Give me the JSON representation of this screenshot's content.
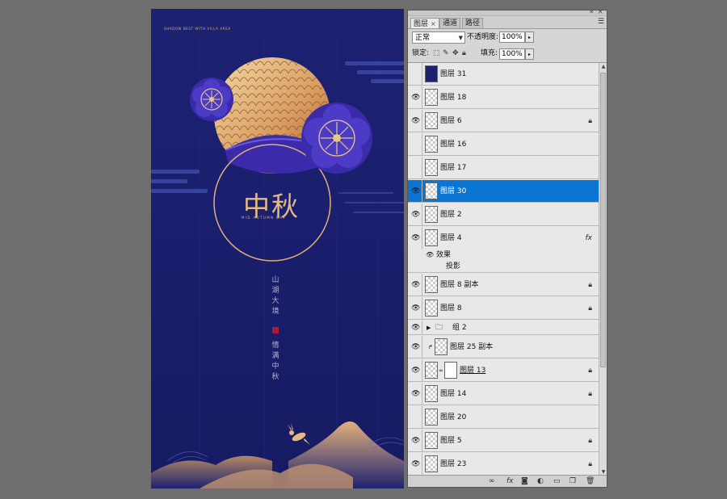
{
  "poster": {
    "tiny_text": "SHADOW BEST WITH VILLA AREA",
    "title": "中秋",
    "subtitle": "MID AUTUMN DAY",
    "vertical_line1": [
      "山",
      "湖",
      "大",
      "境"
    ],
    "vertical_line2": [
      "情",
      "满",
      "中",
      "秋"
    ],
    "colors": {
      "background": "#1c2170",
      "gold": "#e5b982",
      "flower": "#3b2bab",
      "seal": "#b0183b"
    }
  },
  "panel": {
    "top_icons": {
      "collapse": "«",
      "close": "×"
    },
    "tabs": [
      {
        "label": "图层",
        "close": "×",
        "active": true
      },
      {
        "label": "通道",
        "active": false
      },
      {
        "label": "路径",
        "active": false
      }
    ],
    "menu_icon": "panel-menu-icon",
    "blend_mode": "正常",
    "opacity_label": "不透明度:",
    "opacity_value": "100%",
    "lock_label": "锁定:",
    "fill_label": "填充:",
    "fill_value": "100%",
    "arrow": "▸",
    "layers": [
      {
        "name": "图层 31",
        "visible": false,
        "thumb": "navy"
      },
      {
        "name": "图层 18",
        "visible": true
      },
      {
        "name": "图层 6",
        "visible": true,
        "locked": true
      },
      {
        "name": "图层 16",
        "visible": false
      },
      {
        "name": "图层 17",
        "visible": false
      },
      {
        "name": "图层 30",
        "visible": true,
        "selected": true
      },
      {
        "name": "图层 2",
        "visible": true
      },
      {
        "name": "图层 4",
        "visible": true,
        "fx": "fx"
      },
      {
        "name": "图层 8 副本",
        "visible": true,
        "locked": true
      },
      {
        "name": "图层 8",
        "visible": true,
        "locked": true
      },
      {
        "name": "组 2",
        "visible": true,
        "group": true
      },
      {
        "name": "图层 25 副本",
        "visible": true
      },
      {
        "name": "图层 13",
        "visible": true,
        "locked": true,
        "mask": true
      },
      {
        "name": "图层 14",
        "visible": true,
        "locked": true
      },
      {
        "name": "图层 20",
        "visible": false
      },
      {
        "name": "图层 5",
        "visible": true,
        "locked": true
      },
      {
        "name": "图层 23",
        "visible": true,
        "locked": true
      }
    ],
    "effects_label": "效果",
    "effect_item": "投影",
    "bottom_icons": [
      "link-icon",
      "fx-icon",
      "mask-icon",
      "adjustment-icon",
      "folder-icon",
      "new-layer-icon",
      "trash-icon"
    ]
  }
}
